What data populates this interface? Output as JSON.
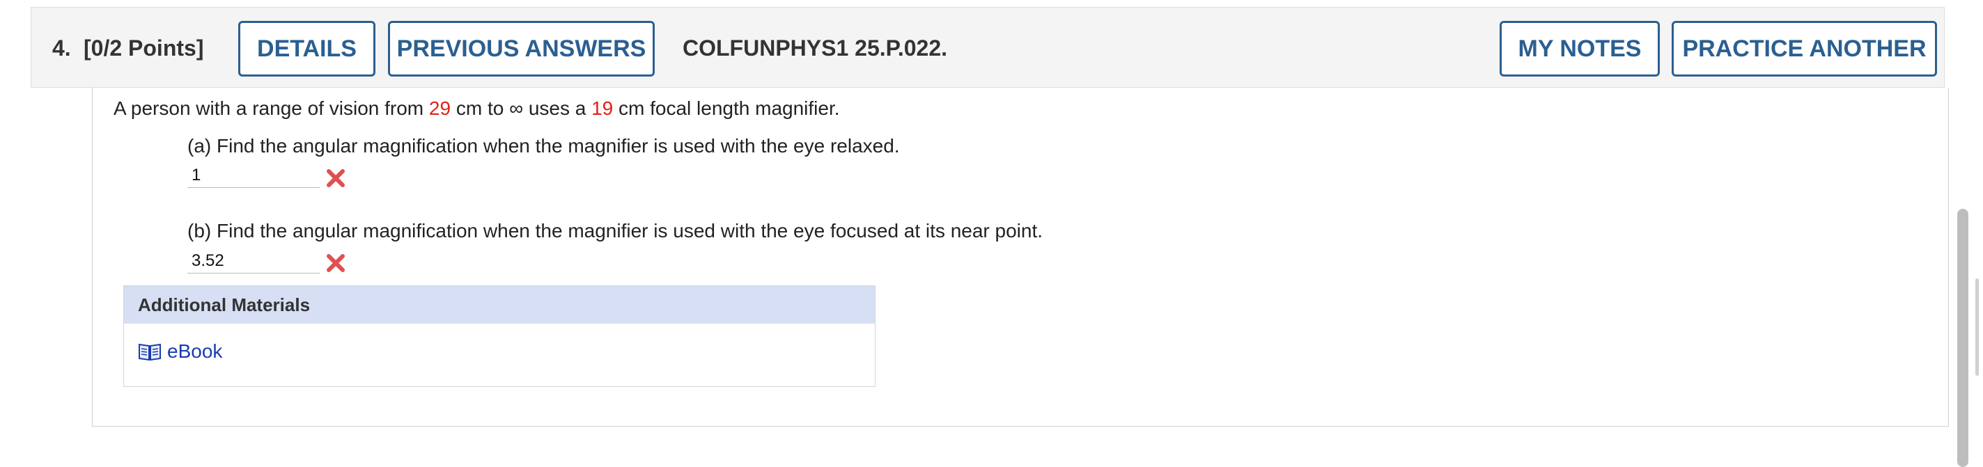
{
  "question": {
    "number": "4.",
    "points": "[0/2 Points]",
    "code": "COLFUNPHYS1 25.P.022.",
    "buttons": {
      "details": "DETAILS",
      "previous_answers": "PREVIOUS ANSWERS",
      "my_notes": "MY NOTES",
      "practice_another": "PRACTICE ANOTHER"
    }
  },
  "problem": {
    "text_1": "A person with a range of vision from ",
    "near_point": "29",
    "text_2": " cm to ∞ uses a ",
    "focal_length": "19",
    "text_3": " cm focal length magnifier.",
    "part_a": {
      "prompt": "(a) Find the angular magnification when the magnifier is used with the eye relaxed.",
      "answer": "1",
      "status": "incorrect"
    },
    "part_b": {
      "prompt": "(b) Find the angular magnification when the magnifier is used with the eye focused at its near point.",
      "answer": "3.52",
      "status": "incorrect"
    }
  },
  "materials": {
    "header": "Additional Materials",
    "ebook_label": "eBook"
  },
  "colors": {
    "accent": "#2b5f91",
    "highlight": "#e4201b",
    "incorrect": "#e05050",
    "materials_header": "#d6dff3",
    "link": "#1a3cb0"
  }
}
